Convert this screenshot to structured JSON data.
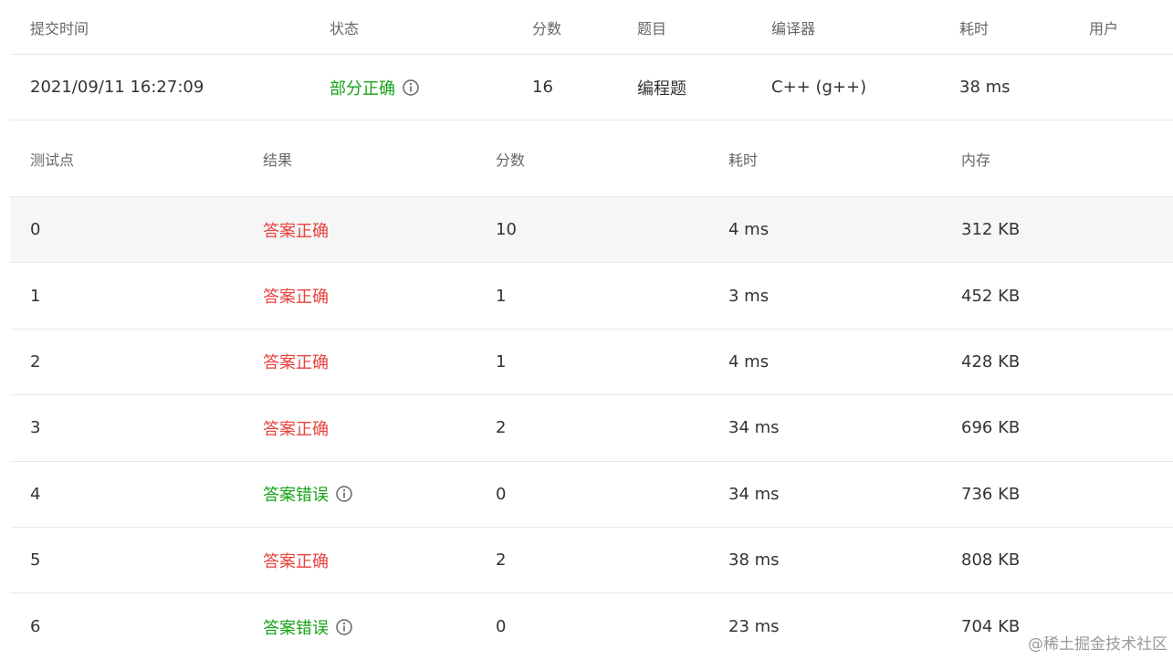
{
  "summary": {
    "headers": {
      "time": "提交时间",
      "status": "状态",
      "score": "分数",
      "problem": "题目",
      "compiler": "编译器",
      "elapsed": "耗时",
      "user": "用户"
    },
    "row": {
      "time": "2021/09/11 16:27:09",
      "status": "部分正确",
      "score": "16",
      "problem": "编程题",
      "compiler": "C++ (g++)",
      "elapsed": "38 ms",
      "user": ""
    }
  },
  "cases": {
    "headers": {
      "id": "测试点",
      "result": "结果",
      "score": "分数",
      "time": "耗时",
      "memory": "内存"
    },
    "rows": [
      {
        "id": "0",
        "result": "答案正确",
        "score": "10",
        "time": "4 ms",
        "memory": "312 KB"
      },
      {
        "id": "1",
        "result": "答案正确",
        "score": "1",
        "time": "3 ms",
        "memory": "452 KB"
      },
      {
        "id": "2",
        "result": "答案正确",
        "score": "1",
        "time": "4 ms",
        "memory": "428 KB"
      },
      {
        "id": "3",
        "result": "答案正确",
        "score": "2",
        "time": "34 ms",
        "memory": "696 KB"
      },
      {
        "id": "4",
        "result": "答案错误",
        "score": "0",
        "time": "34 ms",
        "memory": "736 KB"
      },
      {
        "id": "5",
        "result": "答案正确",
        "score": "2",
        "time": "38 ms",
        "memory": "808 KB"
      },
      {
        "id": "6",
        "result": "答案错误",
        "score": "0",
        "time": "23 ms",
        "memory": "704 KB"
      }
    ]
  },
  "watermark": "@稀土掘金技术社区",
  "colors": {
    "correct_red": "#e8423f",
    "status_green": "#16a316"
  },
  "icons": {
    "info": "info-circle-icon"
  }
}
